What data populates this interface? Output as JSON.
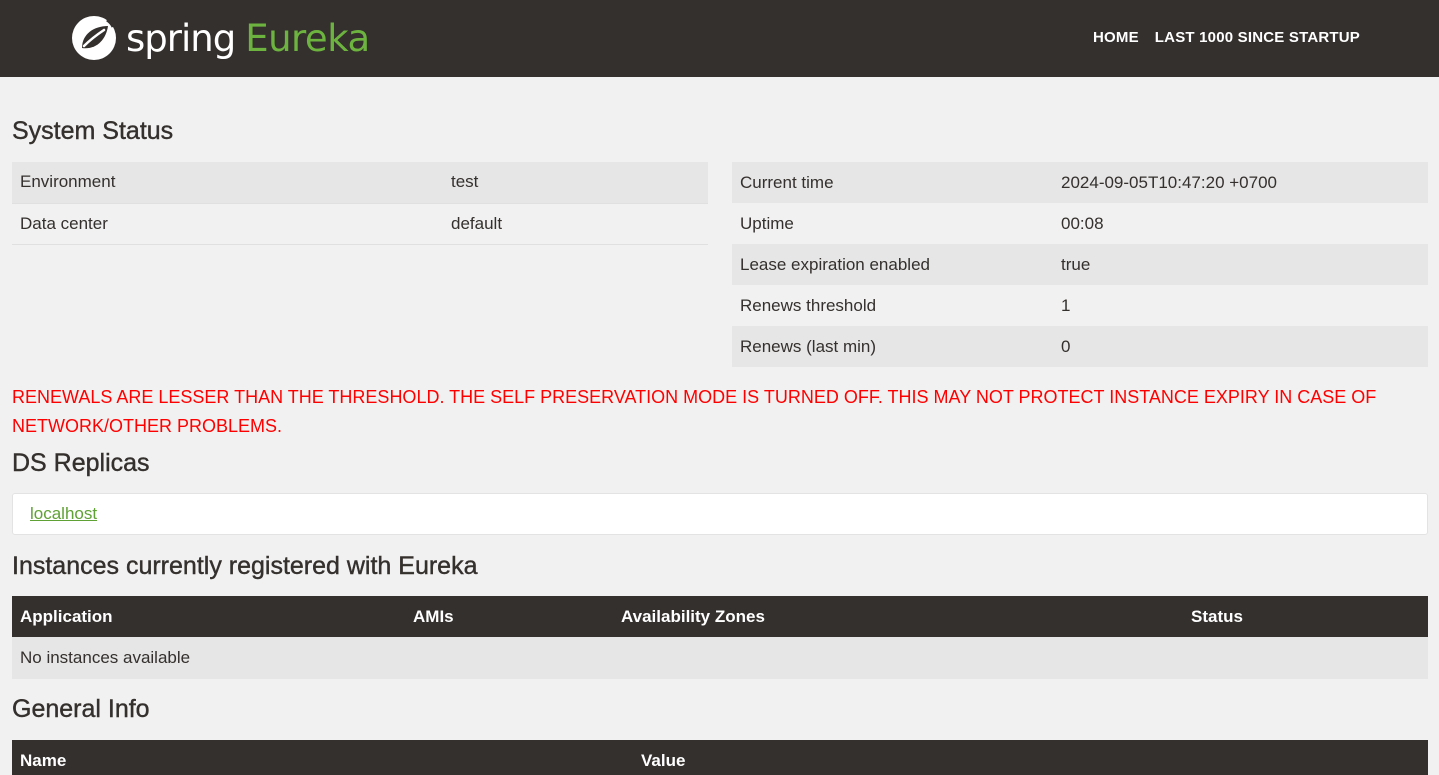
{
  "header": {
    "brand_spring": "spring",
    "brand_eureka": "Eureka",
    "logo_icon": "spring-leaf-icon",
    "nav": [
      {
        "label": "HOME"
      },
      {
        "label": "LAST 1000 SINCE STARTUP"
      }
    ]
  },
  "system_status": {
    "title": "System Status",
    "left": [
      {
        "label": "Environment",
        "value": "test"
      },
      {
        "label": "Data center",
        "value": "default"
      }
    ],
    "right": [
      {
        "label": "Current time",
        "value": "2024-09-05T10:47:20 +0700"
      },
      {
        "label": "Uptime",
        "value": "00:08"
      },
      {
        "label": "Lease expiration enabled",
        "value": "true"
      },
      {
        "label": "Renews threshold",
        "value": "1"
      },
      {
        "label": "Renews (last min)",
        "value": "0"
      }
    ]
  },
  "warning": "RENEWALS ARE LESSER THAN THE THRESHOLD. THE SELF PRESERVATION MODE IS TURNED OFF. THIS MAY NOT PROTECT INSTANCE EXPIRY IN CASE OF NETWORK/OTHER PROBLEMS.",
  "replicas": {
    "title": "DS Replicas",
    "items": [
      {
        "label": "localhost"
      }
    ]
  },
  "instances": {
    "title": "Instances currently registered with Eureka",
    "columns": [
      "Application",
      "AMIs",
      "Availability Zones",
      "Status"
    ],
    "empty_text": "No instances available"
  },
  "general_info": {
    "title": "General Info",
    "columns": [
      "Name",
      "Value"
    ]
  },
  "colors": {
    "navbar": "#34302d",
    "accent_green": "#6db33f",
    "warning_red": "#ff0000",
    "background": "#f1f1f1"
  }
}
